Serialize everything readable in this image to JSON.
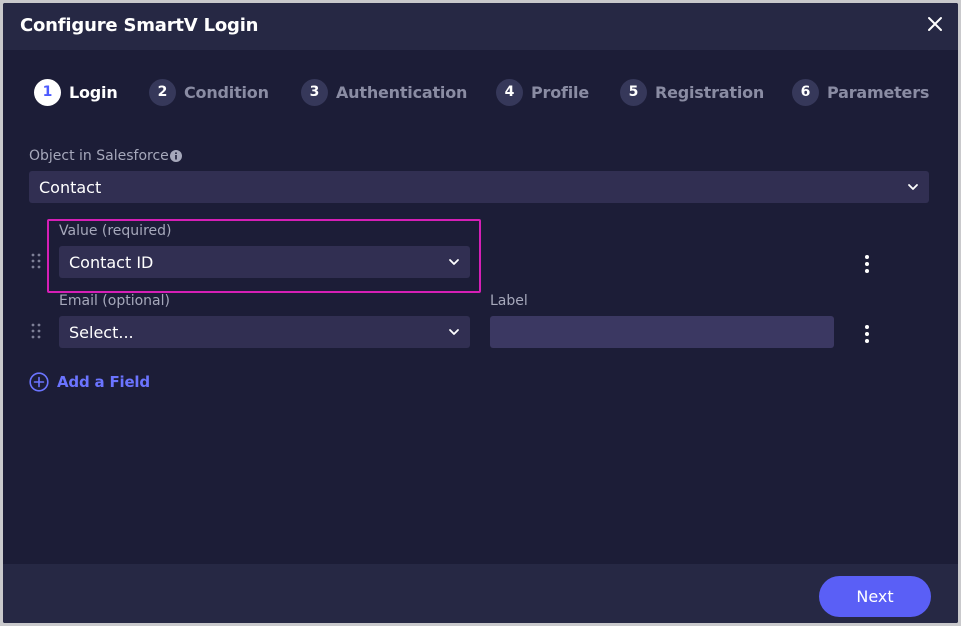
{
  "header": {
    "title": "Configure SmartV Login"
  },
  "steps": [
    {
      "num": "1",
      "label": "Login"
    },
    {
      "num": "2",
      "label": "Condition"
    },
    {
      "num": "3",
      "label": "Authentication"
    },
    {
      "num": "4",
      "label": "Profile"
    },
    {
      "num": "5",
      "label": "Registration"
    },
    {
      "num": "6",
      "label": "Parameters"
    }
  ],
  "object": {
    "label": "Object in Salesforce",
    "value": "Contact"
  },
  "fields": [
    {
      "label": "Value (required)",
      "value": "Contact ID"
    },
    {
      "label": "Email (optional)",
      "value": "Select...",
      "extra_label": "Label",
      "extra_value": ""
    }
  ],
  "add_field_label": "Add a Field",
  "footer": {
    "next_label": "Next"
  },
  "colors": {
    "accent": "#5a5ff6",
    "highlight": "#d51fb6",
    "background": "#1c1d37"
  }
}
